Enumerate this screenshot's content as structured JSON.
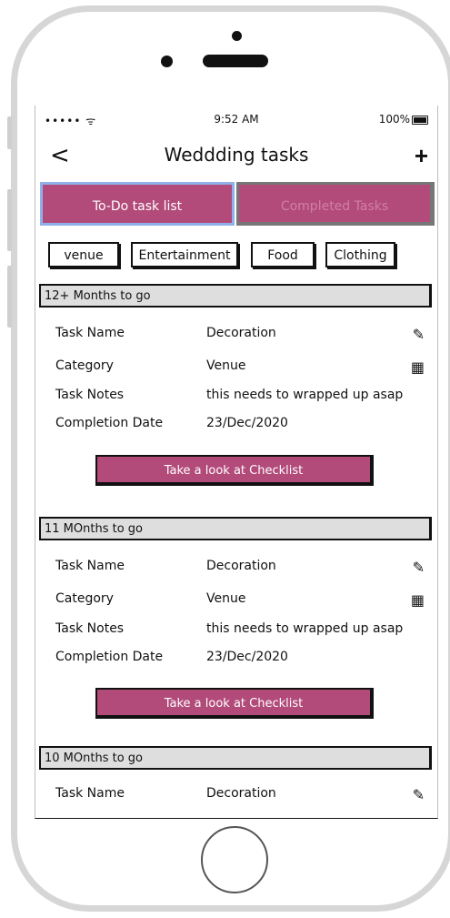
{
  "status_bar": {
    "signal": "••••• ᯤ",
    "time": "9:52 AM",
    "battery": "100%"
  },
  "nav": {
    "back_label": "<",
    "title": "Weddding tasks",
    "add_label": "+"
  },
  "tabs": [
    {
      "label": "To-Do task list",
      "active": true
    },
    {
      "label": "Completed Tasks",
      "active": false
    }
  ],
  "filters": [
    "venue",
    "Entertainment",
    "Food",
    "Clothing"
  ],
  "sections": [
    {
      "header": "12+ Months to go",
      "fields": [
        {
          "label": "Task Name",
          "value": "Decoration",
          "icon": "pencil-icon"
        },
        {
          "label": "Category",
          "value": "Venue",
          "icon": "calendar-icon"
        },
        {
          "label": "Task Notes",
          "value": "this needs to wrapped up asap"
        },
        {
          "label": "Completion Date",
          "value": "23/Dec/2020"
        }
      ],
      "button_label": "Take a look at Checklist"
    },
    {
      "header": "11 MOnths to go",
      "fields": [
        {
          "label": "Task Name",
          "value": "Decoration",
          "icon": "pencil-icon"
        },
        {
          "label": "Category",
          "value": "Venue",
          "icon": "calendar-icon"
        },
        {
          "label": "Task Notes",
          "value": "this needs to wrapped up asap"
        },
        {
          "label": "Completion Date",
          "value": "23/Dec/2020"
        }
      ],
      "button_label": "Take a look at Checklist"
    },
    {
      "header": "10 MOnths to go",
      "fields": [
        {
          "label": "Task Name",
          "value": "Decoration",
          "icon": "pencil-icon"
        }
      ]
    }
  ],
  "colors": {
    "accent": "#b24a7a",
    "header_bg": "#dedede",
    "active_tab_border": "#8fb0e8"
  }
}
